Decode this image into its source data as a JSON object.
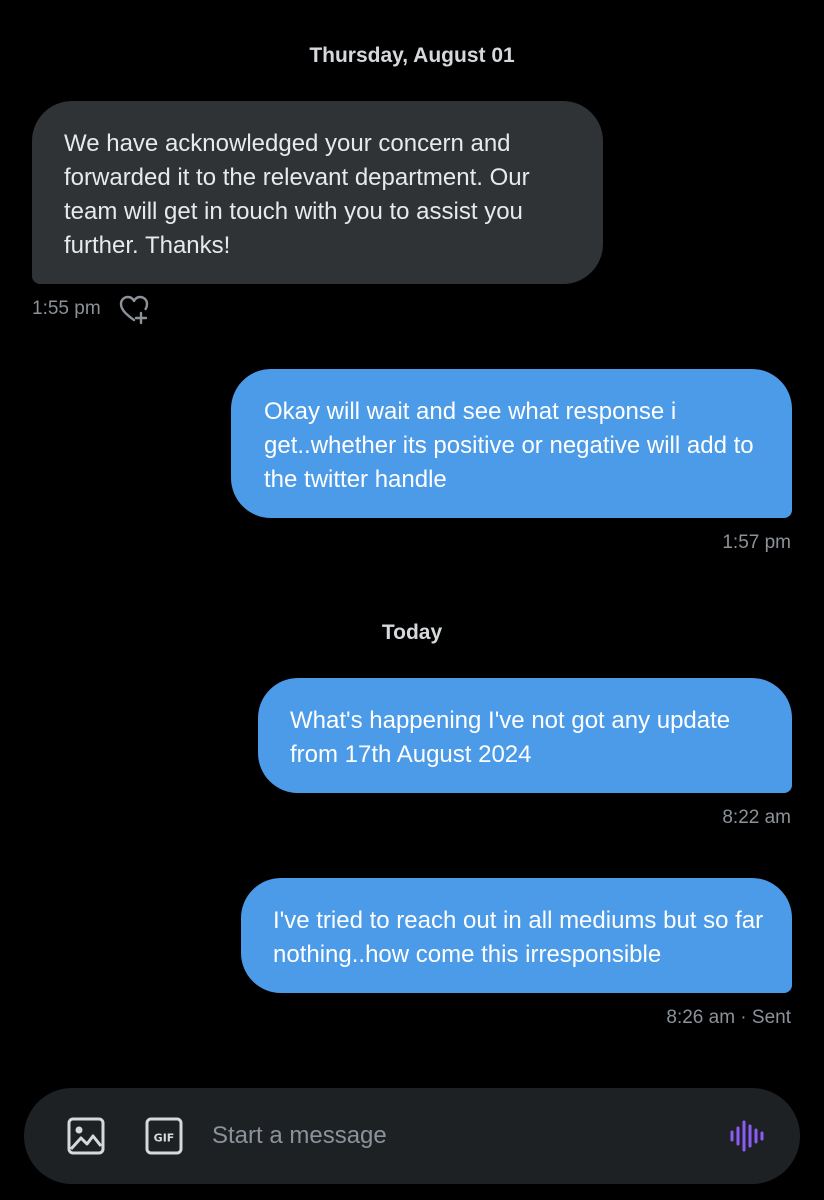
{
  "conversation": {
    "separators": [
      {
        "label": "Thursday, August 01"
      },
      {
        "label": "Today"
      }
    ],
    "messages": [
      {
        "direction": "incoming",
        "text": "We have acknowledged your concern and forwarded it to the relevant department. Our team will get in touch with you to assist you further. Thanks!",
        "time": "1:55 pm"
      },
      {
        "direction": "outgoing",
        "text": "Okay will wait and see what response i get..whether its positive or negative will add to the twitter handle",
        "time": "1:57 pm"
      },
      {
        "direction": "outgoing",
        "text": "What's happening I've not got any update from 17th August 2024",
        "time": "8:22 am"
      },
      {
        "direction": "outgoing",
        "text": "I've tried to reach out in all mediums but so far nothing..how come this irresponsible",
        "time": "8:26 am · Sent"
      }
    ]
  },
  "composer": {
    "placeholder": "Start a message",
    "media_icon": "image-icon",
    "gif_icon": "gif-icon",
    "gif_label": "GIF",
    "voice_icon": "voice-waveform-icon",
    "voice_color": "#8b5cf6"
  },
  "reaction_icon": "heart-add-icon",
  "colors": {
    "background": "#000000",
    "incoming_bubble": "#2f3336",
    "outgoing_bubble": "#4c9be8",
    "timestamp": "#8b9299"
  }
}
